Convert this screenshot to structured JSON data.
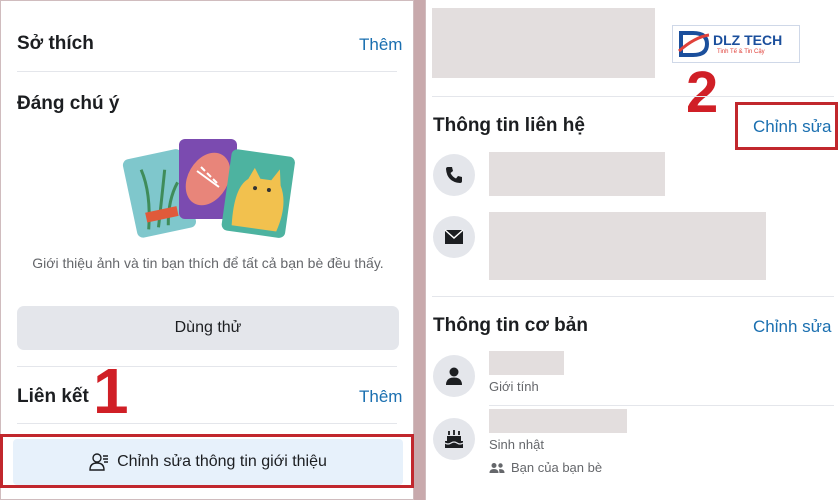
{
  "left": {
    "hobbies": {
      "title": "Sở thích",
      "more": "Thêm"
    },
    "featured": {
      "title": "Đáng chú ý",
      "description": "Giới thiệu ảnh và tin bạn thích để tất cả bạn bè đều thấy.",
      "try_button": "Dùng thử"
    },
    "links": {
      "title": "Liên kết",
      "more": "Thêm"
    },
    "edit_intro_button": "Chỉnh sửa thông tin giới thiệu",
    "step_number": "1"
  },
  "right": {
    "logo": {
      "brand": "DLZ TECH",
      "tagline": "Tinh Tế & Tin Cậy"
    },
    "contact": {
      "title": "Thông tin liên hệ",
      "edit": "Chỉnh sửa"
    },
    "basic": {
      "title": "Thông tin cơ bản",
      "edit": "Chỉnh sửa",
      "gender_label": "Giới tính",
      "birthday_label": "Sinh nhật",
      "audience": "Bạn của bạn bè"
    },
    "step_number": "2"
  },
  "colors": {
    "accent": "#1a6fb0",
    "highlight": "#c1272d",
    "separator": "#c8a9ac"
  },
  "icons": [
    "person-edit-icon",
    "phone-icon",
    "envelope-icon",
    "person-icon",
    "cake-icon",
    "friends-icon"
  ]
}
